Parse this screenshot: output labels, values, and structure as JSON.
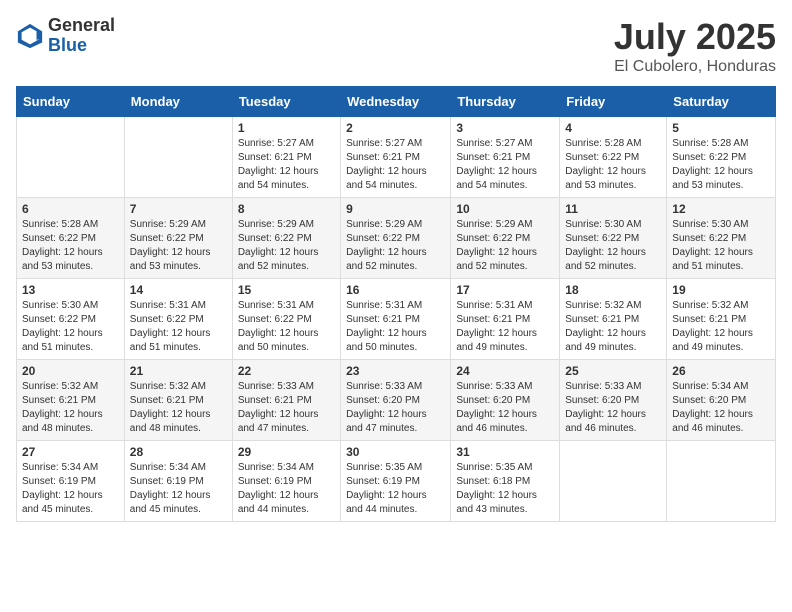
{
  "logo": {
    "general": "General",
    "blue": "Blue"
  },
  "title": "July 2025",
  "location": "El Cubolero, Honduras",
  "days_of_week": [
    "Sunday",
    "Monday",
    "Tuesday",
    "Wednesday",
    "Thursday",
    "Friday",
    "Saturday"
  ],
  "weeks": [
    [
      {
        "day": "",
        "info": ""
      },
      {
        "day": "",
        "info": ""
      },
      {
        "day": "1",
        "info": "Sunrise: 5:27 AM\nSunset: 6:21 PM\nDaylight: 12 hours and 54 minutes."
      },
      {
        "day": "2",
        "info": "Sunrise: 5:27 AM\nSunset: 6:21 PM\nDaylight: 12 hours and 54 minutes."
      },
      {
        "day": "3",
        "info": "Sunrise: 5:27 AM\nSunset: 6:21 PM\nDaylight: 12 hours and 54 minutes."
      },
      {
        "day": "4",
        "info": "Sunrise: 5:28 AM\nSunset: 6:22 PM\nDaylight: 12 hours and 53 minutes."
      },
      {
        "day": "5",
        "info": "Sunrise: 5:28 AM\nSunset: 6:22 PM\nDaylight: 12 hours and 53 minutes."
      }
    ],
    [
      {
        "day": "6",
        "info": "Sunrise: 5:28 AM\nSunset: 6:22 PM\nDaylight: 12 hours and 53 minutes."
      },
      {
        "day": "7",
        "info": "Sunrise: 5:29 AM\nSunset: 6:22 PM\nDaylight: 12 hours and 53 minutes."
      },
      {
        "day": "8",
        "info": "Sunrise: 5:29 AM\nSunset: 6:22 PM\nDaylight: 12 hours and 52 minutes."
      },
      {
        "day": "9",
        "info": "Sunrise: 5:29 AM\nSunset: 6:22 PM\nDaylight: 12 hours and 52 minutes."
      },
      {
        "day": "10",
        "info": "Sunrise: 5:29 AM\nSunset: 6:22 PM\nDaylight: 12 hours and 52 minutes."
      },
      {
        "day": "11",
        "info": "Sunrise: 5:30 AM\nSunset: 6:22 PM\nDaylight: 12 hours and 52 minutes."
      },
      {
        "day": "12",
        "info": "Sunrise: 5:30 AM\nSunset: 6:22 PM\nDaylight: 12 hours and 51 minutes."
      }
    ],
    [
      {
        "day": "13",
        "info": "Sunrise: 5:30 AM\nSunset: 6:22 PM\nDaylight: 12 hours and 51 minutes."
      },
      {
        "day": "14",
        "info": "Sunrise: 5:31 AM\nSunset: 6:22 PM\nDaylight: 12 hours and 51 minutes."
      },
      {
        "day": "15",
        "info": "Sunrise: 5:31 AM\nSunset: 6:22 PM\nDaylight: 12 hours and 50 minutes."
      },
      {
        "day": "16",
        "info": "Sunrise: 5:31 AM\nSunset: 6:21 PM\nDaylight: 12 hours and 50 minutes."
      },
      {
        "day": "17",
        "info": "Sunrise: 5:31 AM\nSunset: 6:21 PM\nDaylight: 12 hours and 49 minutes."
      },
      {
        "day": "18",
        "info": "Sunrise: 5:32 AM\nSunset: 6:21 PM\nDaylight: 12 hours and 49 minutes."
      },
      {
        "day": "19",
        "info": "Sunrise: 5:32 AM\nSunset: 6:21 PM\nDaylight: 12 hours and 49 minutes."
      }
    ],
    [
      {
        "day": "20",
        "info": "Sunrise: 5:32 AM\nSunset: 6:21 PM\nDaylight: 12 hours and 48 minutes."
      },
      {
        "day": "21",
        "info": "Sunrise: 5:32 AM\nSunset: 6:21 PM\nDaylight: 12 hours and 48 minutes."
      },
      {
        "day": "22",
        "info": "Sunrise: 5:33 AM\nSunset: 6:21 PM\nDaylight: 12 hours and 47 minutes."
      },
      {
        "day": "23",
        "info": "Sunrise: 5:33 AM\nSunset: 6:20 PM\nDaylight: 12 hours and 47 minutes."
      },
      {
        "day": "24",
        "info": "Sunrise: 5:33 AM\nSunset: 6:20 PM\nDaylight: 12 hours and 46 minutes."
      },
      {
        "day": "25",
        "info": "Sunrise: 5:33 AM\nSunset: 6:20 PM\nDaylight: 12 hours and 46 minutes."
      },
      {
        "day": "26",
        "info": "Sunrise: 5:34 AM\nSunset: 6:20 PM\nDaylight: 12 hours and 46 minutes."
      }
    ],
    [
      {
        "day": "27",
        "info": "Sunrise: 5:34 AM\nSunset: 6:19 PM\nDaylight: 12 hours and 45 minutes."
      },
      {
        "day": "28",
        "info": "Sunrise: 5:34 AM\nSunset: 6:19 PM\nDaylight: 12 hours and 45 minutes."
      },
      {
        "day": "29",
        "info": "Sunrise: 5:34 AM\nSunset: 6:19 PM\nDaylight: 12 hours and 44 minutes."
      },
      {
        "day": "30",
        "info": "Sunrise: 5:35 AM\nSunset: 6:19 PM\nDaylight: 12 hours and 44 minutes."
      },
      {
        "day": "31",
        "info": "Sunrise: 5:35 AM\nSunset: 6:18 PM\nDaylight: 12 hours and 43 minutes."
      },
      {
        "day": "",
        "info": ""
      },
      {
        "day": "",
        "info": ""
      }
    ]
  ]
}
